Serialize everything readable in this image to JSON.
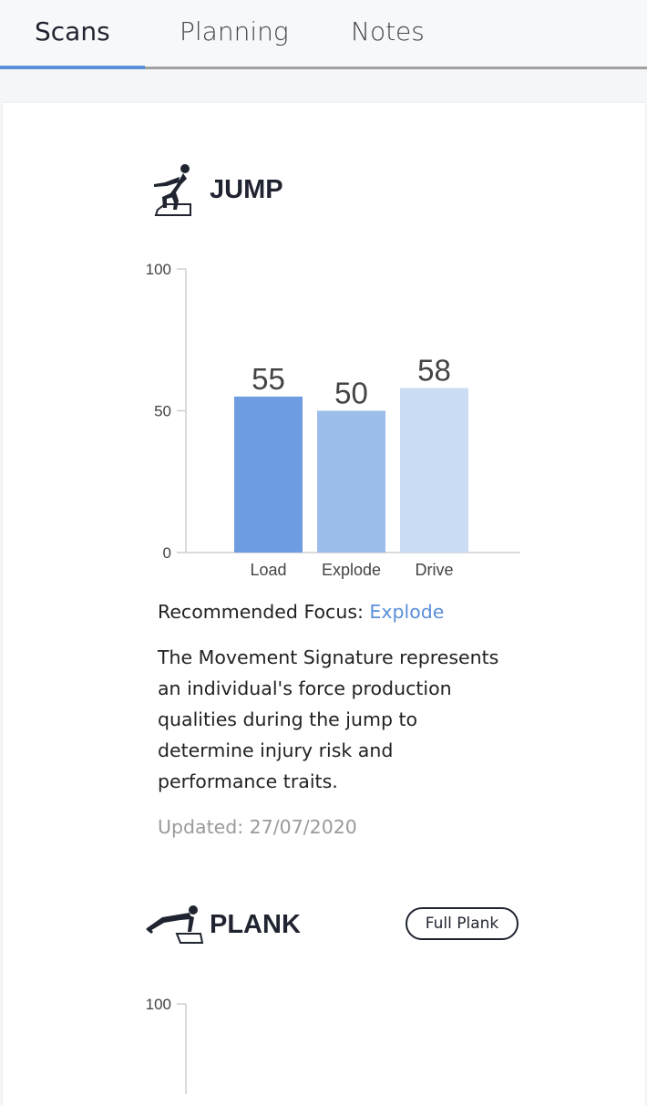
{
  "tabs": [
    {
      "label": "Scans",
      "active": true
    },
    {
      "label": "Planning",
      "active": false
    },
    {
      "label": "Notes",
      "active": false
    }
  ],
  "jump": {
    "icon": "jump-figure-icon",
    "title": "JUMP",
    "focus_label": "Recommended Focus: ",
    "focus_value": "Explode",
    "description": "The Movement Signature represents an individual's force production qualities during the jump to determine injury risk and performance traits.",
    "updated": "Updated: 27/07/2020"
  },
  "plank": {
    "icon": "plank-figure-icon",
    "title": "PLANK",
    "badge": "Full Plank"
  },
  "colors": {
    "accent": "#5b8fd8",
    "bar_load": "#6d9ce0",
    "bar_explode": "#9dbdea",
    "bar_drive": "#cbddf5"
  },
  "chart_data": [
    {
      "type": "bar",
      "categories": [
        "Load",
        "Explode",
        "Drive"
      ],
      "values": [
        55,
        50,
        58
      ],
      "ylim": [
        0,
        100
      ],
      "yticks": [
        0,
        50,
        100
      ],
      "title": "",
      "xlabel": "",
      "ylabel": "",
      "grid": false
    },
    {
      "type": "bar",
      "categories": [],
      "values": [],
      "ylim": [
        0,
        100
      ],
      "yticks": [
        100
      ],
      "title": "",
      "xlabel": "",
      "ylabel": "",
      "grid": false
    }
  ]
}
